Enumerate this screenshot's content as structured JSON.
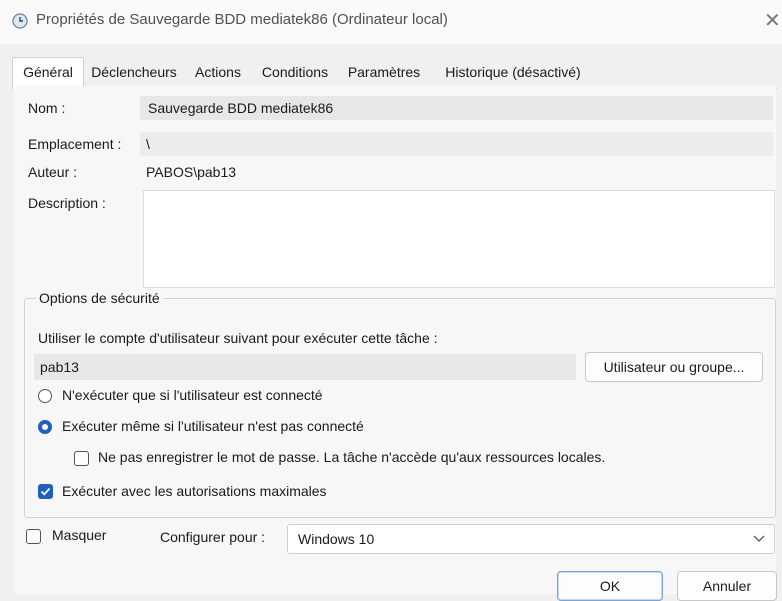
{
  "window": {
    "title": "Propriétés de Sauvegarde BDD mediatek86 (Ordinateur local)",
    "close": "✕"
  },
  "tabs": [
    {
      "label": "Général",
      "active": true
    },
    {
      "label": "Déclencheurs",
      "active": false
    },
    {
      "label": "Actions",
      "active": false
    },
    {
      "label": "Conditions",
      "active": false
    },
    {
      "label": "Paramètres",
      "active": false
    },
    {
      "label": "Historique (désactivé)",
      "active": false
    }
  ],
  "general": {
    "name_label": "Nom :",
    "name_value": "Sauvegarde BDD mediatek86",
    "location_label": "Emplacement :",
    "location_value": "\\",
    "author_label": "Auteur :",
    "author_value": "PABOS\\pab13",
    "description_label": "Description :",
    "description_value": ""
  },
  "security": {
    "title": "Options de sécurité",
    "account_prompt": "Utiliser le compte d'utilisateur suivant pour exécuter cette tâche :",
    "account_value": "pab13",
    "user_group_button": "Utilisateur ou groupe...",
    "radio_logged_on": {
      "label": "N'exécuter que si l'utilisateur est connecté",
      "checked": false
    },
    "radio_whether_logged": {
      "label": "Exécuter même si l'utilisateur n'est pas connecté",
      "checked": true
    },
    "no_store_password": {
      "label": "Ne pas enregistrer le mot de passe. La tâche n'accède qu'aux ressources locales.",
      "checked": false
    },
    "highest_privileges": {
      "label": "Exécuter avec les autorisations maximales",
      "checked": true
    }
  },
  "footer": {
    "hidden_label": "Masquer",
    "hidden_checked": false,
    "configure_label": "Configurer pour :",
    "configure_value": "Windows 10",
    "ok_button": "OK",
    "cancel_button": "Annuler"
  },
  "colors": {
    "accent": "#1f5fbf",
    "background": "#f0f0f0",
    "field": "#e7e7e7"
  }
}
